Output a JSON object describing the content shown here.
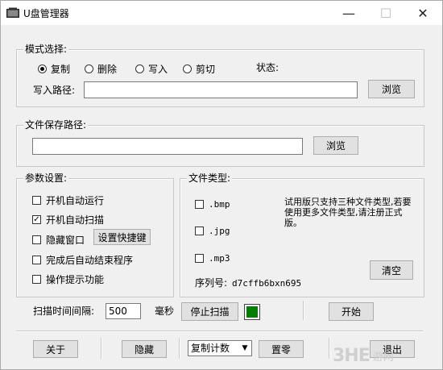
{
  "window": {
    "title": "U盘管理器",
    "minimize_glyph": "—",
    "maximize_glyph": "☐",
    "close_glyph": "✕"
  },
  "mode": {
    "legend": "模式选择:",
    "options": [
      "复制",
      "删除",
      "写入",
      "剪切"
    ],
    "selected": "复制",
    "status_label": "状态:",
    "write_path_label": "写入路径:",
    "write_path_value": "",
    "browse_label": "浏览"
  },
  "save": {
    "legend": "文件保存路径:",
    "path_value": "",
    "browse_label": "浏览"
  },
  "params": {
    "legend": "参数设置:",
    "items": [
      {
        "label": "开机自动运行",
        "checked": false
      },
      {
        "label": "开机自动扫描",
        "checked": true
      },
      {
        "label": "隐藏窗口",
        "checked": false
      },
      {
        "label": "完成后自动结束程序",
        "checked": false
      },
      {
        "label": "操作提示功能",
        "checked": false
      }
    ],
    "hotkey_button": "设置快捷键"
  },
  "filetypes": {
    "legend": "文件类型:",
    "items": [
      {
        "label": ".bmp",
        "checked": false
      },
      {
        "label": ".jpg",
        "checked": false
      },
      {
        "label": ".mp3",
        "checked": false
      }
    ],
    "trial_note": "试用版只支持三种文件类型,若要使用更多文件类型,请注册正式版。",
    "clear_label": "清空",
    "serial_label": "序列号:",
    "serial_value": "d7cffb6bxn695"
  },
  "scan": {
    "interval_label": "扫描时间间隔:",
    "interval_value": "500",
    "unit": "毫秒",
    "stop_label": "停止扫描",
    "indicator_color": "#008000",
    "start_label": "开始"
  },
  "bottom": {
    "about_label": "关于",
    "hide_label": "隐藏",
    "counter_select": "复制计数",
    "reset_label": "置零",
    "exit_label": "退出"
  },
  "watermark": {
    "logo": "3HE",
    "text": "游网"
  },
  "colors": {
    "background": "#f0f0f0",
    "focus_border": "#0078d7"
  }
}
